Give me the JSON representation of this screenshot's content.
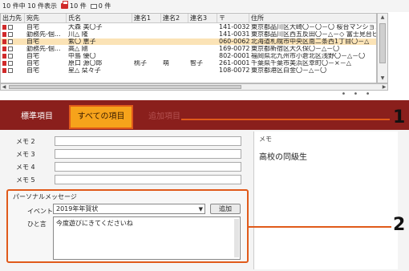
{
  "status": {
    "records_text": "10 件中 10 件表示",
    "print_count": "10 件",
    "mail_count": "0 件"
  },
  "grid": {
    "headers": [
      "出力先",
      "宛先",
      "氏名",
      "連名1",
      "連名2",
      "連名3",
      "〒",
      "住所"
    ],
    "rows": [
      {
        "dest": "自宅",
        "name": "大森 美〇子",
        "ren1": "",
        "ren2": "",
        "ren3": "",
        "zip": "141-0032",
        "addr": "東京都品川区大崎〇－〇－〇 桜台マンション",
        "selected": false
      },
      {
        "dest": "勤務先-個...",
        "name": "川△ 隆",
        "ren1": "",
        "ren2": "",
        "ren3": "",
        "zip": "141-0031",
        "addr": "東京都品川区西五反田〇－△－◇ 富士見台ビ",
        "selected": false
      },
      {
        "dest": "自宅",
        "name": "紫〇 恵子",
        "ren1": "",
        "ren2": "",
        "ren3": "",
        "zip": "060-0062",
        "addr": "北海道札幌市中央区南二条西1丁目〇－△",
        "selected": true
      },
      {
        "dest": "勤務先-個...",
        "name": "高△ 剛",
        "ren1": "",
        "ren2": "",
        "ren3": "",
        "zip": "169-0072",
        "addr": "東京都新宿区大久保〇－△－〇",
        "selected": false
      },
      {
        "dest": "自宅",
        "name": "中島 優〇",
        "ren1": "",
        "ren2": "",
        "ren3": "",
        "zip": "802-0001",
        "addr": "福岡県北九州市小倉北区浅野〇－△－〇",
        "selected": false
      },
      {
        "dest": "自宅",
        "name": "原口 源〇郎",
        "ren1": "桃子",
        "ren2": "萌",
        "ren3": "智子",
        "zip": "261-0001",
        "addr": "千葉県千葉市美浜区幸町〇－×－△",
        "selected": false
      },
      {
        "dest": "自宅",
        "name": "星△ 栞々子",
        "ren1": "",
        "ren2": "",
        "ren3": "",
        "zip": "108-0072",
        "addr": "東京都港区白金〇－△－〇",
        "selected": false
      }
    ]
  },
  "splitter": {
    "dots": "• • •"
  },
  "tabs": [
    {
      "label": "標準項目"
    },
    {
      "label": "すべての項目"
    },
    {
      "label": "追加項目"
    }
  ],
  "memos": [
    {
      "label": "メモ 2",
      "value": ""
    },
    {
      "label": "メモ 3",
      "value": ""
    },
    {
      "label": "メモ 4",
      "value": ""
    },
    {
      "label": "メモ 5",
      "value": ""
    }
  ],
  "memo_display": {
    "title": "メモ",
    "text": "高校の同級生"
  },
  "personal_message": {
    "title": "パーソナルメッセージ",
    "event_label": "イベント",
    "event_value": "2019年年賀状",
    "add_label": "追加",
    "message_label": "ひと言",
    "message_value": "今度遊びにきてくださいね"
  },
  "callouts": {
    "one": "1",
    "two": "2"
  },
  "colors": {
    "tab_bar": "#8a1f1c",
    "active_tab": "#f6a31b",
    "callout": "#e05a1a",
    "selected_row": "#fbe3b6"
  }
}
